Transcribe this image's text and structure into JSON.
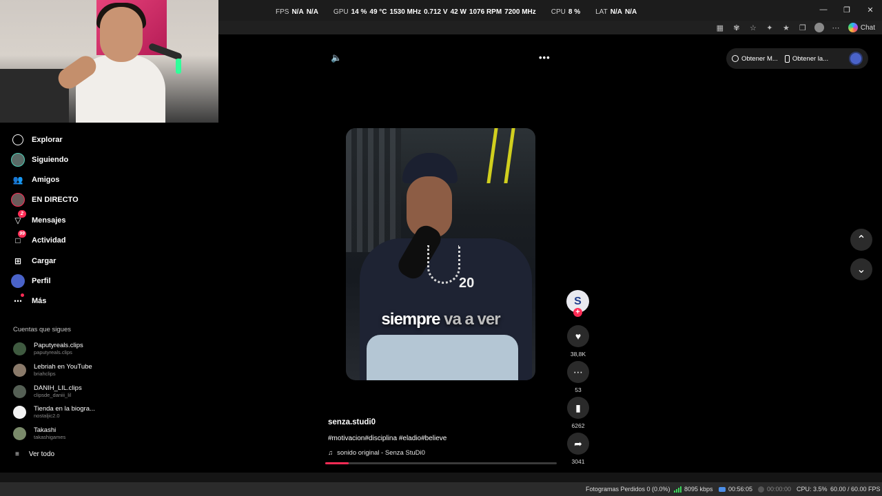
{
  "perf_overlay": {
    "fps_label": "FPS",
    "fps_values": [
      "N/A",
      "N/A"
    ],
    "gpu_label": "GPU",
    "gpu_usage": "14 %",
    "gpu_temp": "49 °C",
    "gpu_clock": "1530 MHz",
    "gpu_voltage": "0.712 V",
    "gpu_power": "42 W",
    "gpu_fan": "1076 RPM",
    "gpu_mem": "7200 MHz",
    "cpu_label": "CPU",
    "cpu_usage": "8 %",
    "lat_label": "LAT",
    "lat_values": [
      "N/A",
      "N/A"
    ]
  },
  "browser": {
    "copilot_label": "Chat"
  },
  "sidebar": {
    "items": [
      {
        "label": "Explorar"
      },
      {
        "label": "Siguiendo"
      },
      {
        "label": "Amigos"
      },
      {
        "label": "EN DIRECTO"
      },
      {
        "label": "Mensajes",
        "badge": "2"
      },
      {
        "label": "Actividad",
        "badge": "99"
      },
      {
        "label": "Cargar"
      },
      {
        "label": "Perfil"
      },
      {
        "label": "Más"
      }
    ],
    "following_title": "Cuentas que sigues",
    "following": [
      {
        "name": "Paputyreals.clips",
        "handle": "paputyreals.clips"
      },
      {
        "name": "Lebriah en YouTube",
        "handle": "briahclips"
      },
      {
        "name": "DANIH_LIL.clips",
        "handle": "clipsde_daniii_lil"
      },
      {
        "name": "Tienda en la biogra...",
        "handle": "nostaljic2.0"
      },
      {
        "name": "Takashi",
        "handle": "takashigames"
      }
    ],
    "see_all": "Ver todo"
  },
  "top_pill": {
    "item1": "Obtener M...",
    "item2": "Obtener la..."
  },
  "video": {
    "caption_main": "siempre",
    "caption_rest": " va a ver",
    "jersey_number": "20",
    "creator_initial": "S",
    "username": "senza.studi0",
    "hashtags": "#motivacion#disciplina #eladio#believe",
    "sound": "sonido original - Senza StuDi0",
    "progress": 0.1
  },
  "actions": {
    "likes": "38,8K",
    "comments": "53",
    "saves": "6262",
    "shares": "3041"
  },
  "status": {
    "dropped": "Fotogramas Perdidos 0 (0.0%)",
    "bitrate": "8095 kbps",
    "stream_time": "00:56:05",
    "rec_time": "00:00:00",
    "cpu": "CPU: 3.5%",
    "fps": "60.00 / 60.00 FPS"
  },
  "colors": {
    "accent": "#fe2c55",
    "background": "#000000",
    "panel": "#2a2a2a"
  }
}
